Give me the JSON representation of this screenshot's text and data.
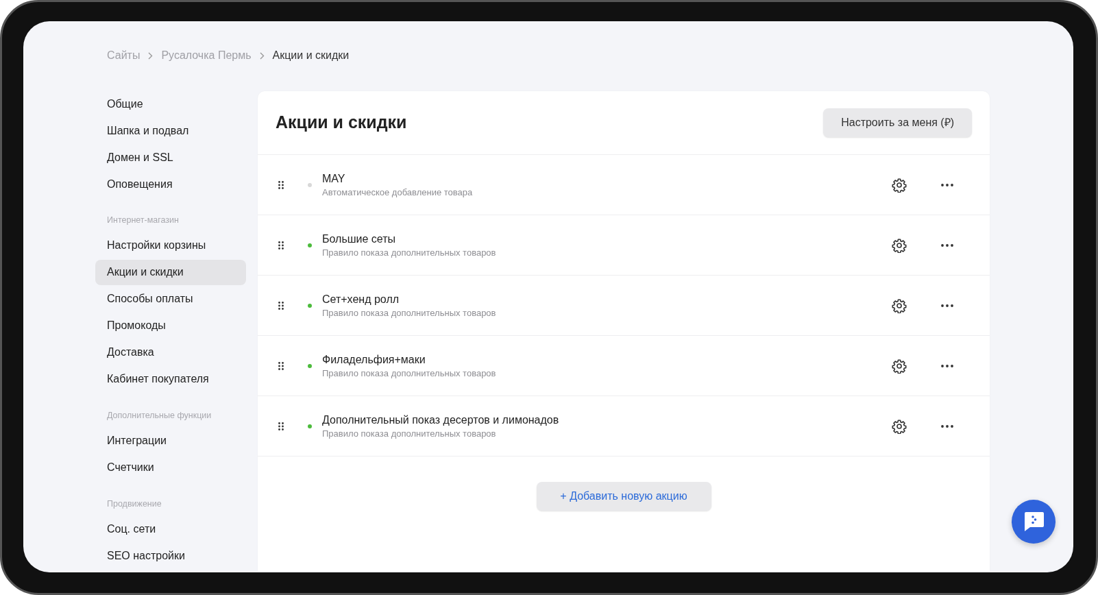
{
  "breadcrumbs": [
    "Сайты",
    "Русалочка Пермь",
    "Акции и скидки"
  ],
  "sidebar": {
    "groups": [
      {
        "items": [
          {
            "label": "Общие",
            "selected": false
          },
          {
            "label": "Шапка и подвал",
            "selected": false
          },
          {
            "label": "Домен и SSL",
            "selected": false
          },
          {
            "label": "Оповещения",
            "selected": false
          }
        ]
      },
      {
        "heading": "Интернет-магазин",
        "items": [
          {
            "label": "Настройки корзины",
            "selected": false
          },
          {
            "label": "Акции и скидки",
            "selected": true
          },
          {
            "label": "Способы оплаты",
            "selected": false
          },
          {
            "label": "Промокоды",
            "selected": false
          },
          {
            "label": "Доставка",
            "selected": false
          },
          {
            "label": "Кабинет покупателя",
            "selected": false
          }
        ]
      },
      {
        "heading": "Дополнительные функции",
        "items": [
          {
            "label": "Интеграции",
            "selected": false
          },
          {
            "label": "Счетчики",
            "selected": false
          }
        ]
      },
      {
        "heading": "Продвижение",
        "items": [
          {
            "label": "Соц. сети",
            "selected": false
          },
          {
            "label": "SEO настройки",
            "selected": false
          }
        ]
      }
    ]
  },
  "page": {
    "title": "Акции и скидки",
    "action_button": "Настроить за меня (₽)",
    "promotions": [
      {
        "name": "MAY",
        "description": "Автоматическое добавление товара",
        "active": false
      },
      {
        "name": "Большие сеты",
        "description": "Правило показа дополнительных товаров",
        "active": true
      },
      {
        "name": "Сет+хенд ролл",
        "description": "Правило показа дополнительных товаров",
        "active": true
      },
      {
        "name": "Филадельфия+маки",
        "description": "Правило показа дополнительных товаров",
        "active": true
      },
      {
        "name": "Дополнительный показ десертов и лимонадов",
        "description": "Правило показа дополнительных товаров",
        "active": true
      }
    ],
    "add_button": "+ Добавить новую акцию"
  }
}
